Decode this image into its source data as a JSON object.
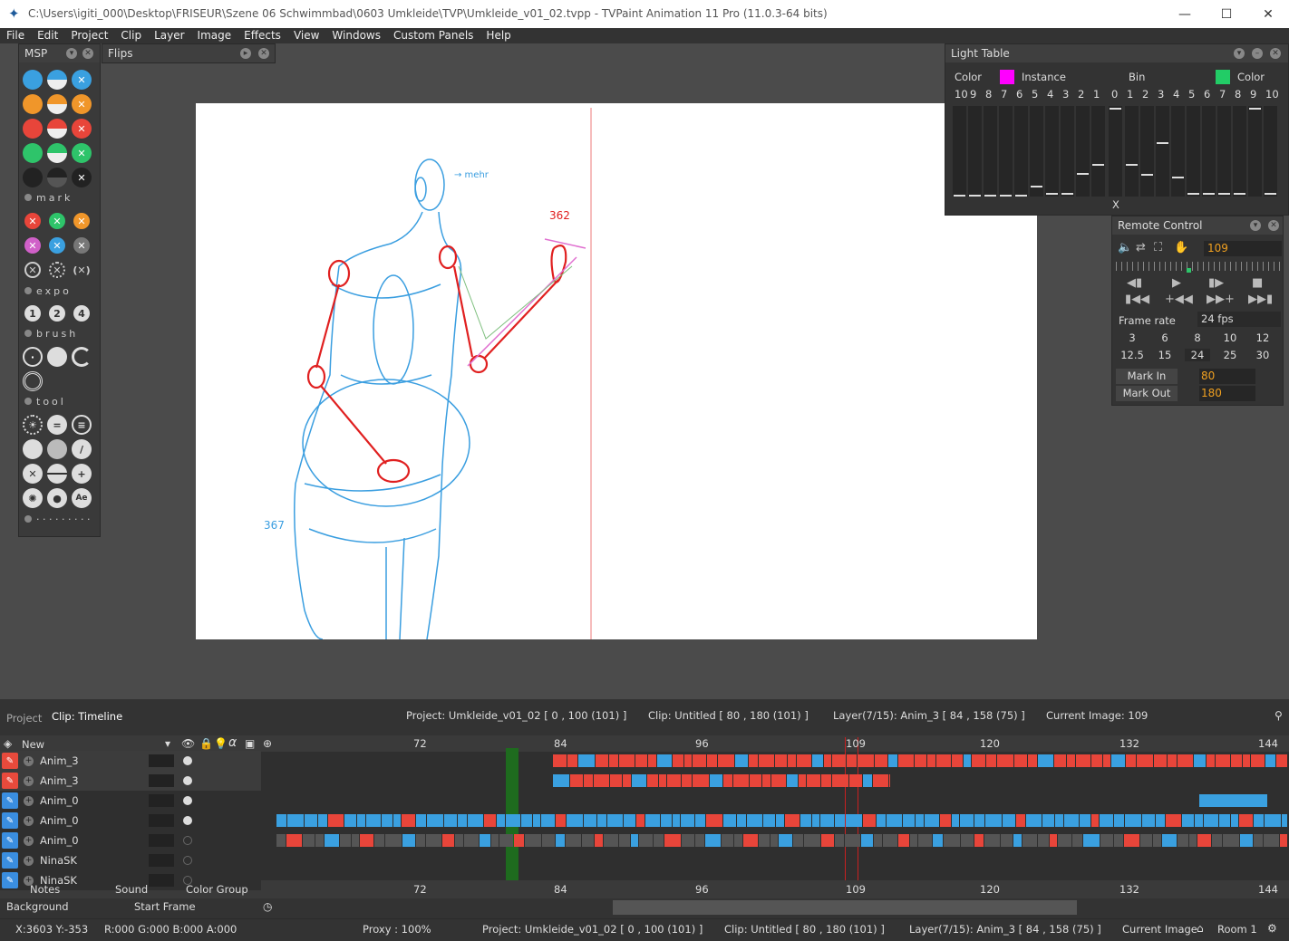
{
  "titlebar": {
    "title": "C:\\Users\\igiti_000\\Desktop\\FRISEUR\\Szene 06 Schwimmbad\\0603 Umkleide\\TVP\\Umkleide_v01_02.tvpp - TVPaint Animation 11 Pro (11.0.3-64 bits)",
    "minimize": "—",
    "maximize": "☐",
    "close": "✕"
  },
  "menu": [
    "File",
    "Edit",
    "Project",
    "Clip",
    "Layer",
    "Image",
    "Effects",
    "View",
    "Windows",
    "Custom Panels",
    "Help"
  ],
  "msp": {
    "title": "MSP",
    "sections": [
      "mark",
      "expo",
      "brush",
      "tool"
    ],
    "more": "· · · · · · · · ·",
    "expo_labels": [
      "1",
      "2",
      "4"
    ],
    "ae_label": "Ae"
  },
  "flips": {
    "title": "Flips"
  },
  "canvas": {
    "annotation_top": "→ mehr",
    "annotation_red": "362",
    "annotation_bottom": "367"
  },
  "lighttable": {
    "title": "Light Table",
    "color_left": "Color",
    "instance": "Instance",
    "bin": "Bin",
    "color_right": "Color",
    "left_numbers": [
      "10",
      "9",
      "8",
      "7",
      "6",
      "5",
      "4",
      "3",
      "2",
      "1"
    ],
    "center": "0",
    "right_numbers": [
      "1",
      "2",
      "3",
      "4",
      "5",
      "6",
      "7",
      "8",
      "9",
      "10"
    ],
    "x_label": "X",
    "colors": {
      "instance": "#ff00ff",
      "bin": "#22cc66"
    }
  },
  "remote": {
    "title": "Remote Control",
    "current_frame": "109",
    "frame_rate_label": "Frame rate",
    "frame_rate_value": "24 fps",
    "fps_row1": [
      "3",
      "6",
      "8",
      "10",
      "12"
    ],
    "fps_row2": [
      "12.5",
      "15",
      "24",
      "25",
      "30"
    ],
    "mark_in_label": "Mark In",
    "mark_in_value": "80",
    "mark_out_label": "Mark Out",
    "mark_out_value": "180",
    "accent": "#f0a020"
  },
  "timeline": {
    "tab_project": "Project",
    "tab_clip": "Clip: Timeline",
    "info_project": "Project: Umkleide_v01_02 [ 0 , 100  (101) ]",
    "info_clip": "Clip: Untitled [ 80 , 180  (101) ]",
    "info_layer": "Layer(7/15): Anim_3 [ 84 , 158  (75) ]",
    "info_current": "Current Image: 109",
    "new_label": "New",
    "alpha_label": "α",
    "ruler": [
      "72",
      "84",
      "96",
      "109",
      "120",
      "132",
      "144"
    ],
    "layers": [
      {
        "name": "Anim_3",
        "color": "#e84a3c"
      },
      {
        "name": "Anim_3",
        "color": "#e84a3c"
      },
      {
        "name": "Anim_0",
        "color": "#3a8ee0"
      },
      {
        "name": "Anim_0",
        "color": "#3a8ee0"
      },
      {
        "name": "Anim_0",
        "color": "#3a8ee0"
      },
      {
        "name": "NinaSK",
        "color": "#3a8ee0"
      },
      {
        "name": "NinaSK",
        "color": "#3a8ee0"
      }
    ],
    "bottom_tabs": [
      "Notes",
      "Sound",
      "Color Group"
    ],
    "background_label": "Background",
    "start_frame_label": "Start Frame"
  },
  "status": {
    "coords": "X:3603  Y:-353",
    "rgba": "R:000 G:000 B:000 A:000",
    "proxy": "Proxy : 100%",
    "project": "Project: Umkleide_v01_02 [ 0 , 100  (101) ]",
    "clip": "Clip: Untitled [ 80 , 180  (101) ]",
    "layer": "Layer(7/15): Anim_3 [ 84 , 158  (75) ]",
    "current": "Current Image",
    "room": "Room 1"
  }
}
